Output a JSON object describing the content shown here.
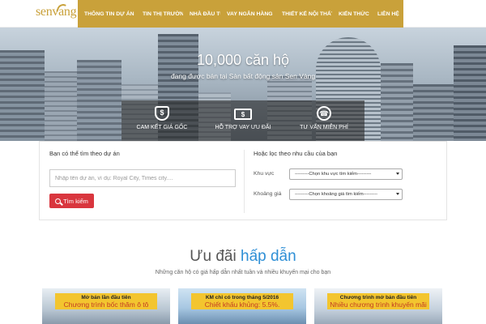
{
  "brand": {
    "logo_text": "senvang",
    "color": "#c9a13a"
  },
  "nav": {
    "items": [
      {
        "label": "THÔNG TIN DỰ ÁN"
      },
      {
        "label": "TIN THỊ TRƯỜNG"
      },
      {
        "label": "NHÀ ĐẦU TƯ"
      },
      {
        "label": "VAY NGÂN HÀNG"
      },
      {
        "label": "THIẾT KẾ NỘI THẤT"
      },
      {
        "label": "KIẾN THỨC"
      },
      {
        "label": "LIÊN HỆ"
      }
    ]
  },
  "hero": {
    "title": "10,000 căn hộ",
    "subtitle": "đang được bán tại Sàn bất động sản Sen Vàng",
    "benefits": [
      {
        "icon": "dollar-shield-icon",
        "label": "CAM KẾT GIÁ GỐC"
      },
      {
        "icon": "money-bill-icon",
        "label": "HỖ TRỢ VAY ƯU ĐÃI"
      },
      {
        "icon": "chat-phone-icon",
        "label": "TƯ VẤN MIỄN PHÍ"
      }
    ]
  },
  "search": {
    "left_title": "Bạn có thể tìm theo dự án",
    "input_placeholder": "Nhập tên dự án, ví dụ: Royal City, Times city....",
    "button_label": "Tìm kiếm",
    "right_title": "Hoặc lọc theo nhu cầu của bạn",
    "filters": [
      {
        "label": "Khu vực",
        "selected": "---------Chọn khu vực tìm kiếm---------"
      },
      {
        "label": "Khoảng giá",
        "selected": "---------Chọn khoảng giá tìm kiếm---------"
      }
    ]
  },
  "offers": {
    "title_part1": "Ưu đãi",
    "title_part2": "hấp dẫn",
    "subtitle": "Những căn hộ có giá hấp dẫn nhất tuần và nhiều khuyến mại cho bạn",
    "cards": [
      {
        "badge_title": "Mở bán lần đầu tiên",
        "badge_text": "Chương trình bốc thăm ô tô"
      },
      {
        "badge_title": "KM chỉ có trong tháng 5/2016",
        "badge_text": "Chiết khấu khủng: 5.5%."
      },
      {
        "badge_title": "Chương trình mở bán đầu tiên",
        "badge_text": "Nhiều chương trình khuyến mãi"
      }
    ]
  },
  "colors": {
    "accent_gold": "#c9a13a",
    "button_red": "#d9363e",
    "badge_yellow": "#f3c52f",
    "title_blue": "#2e8fd6"
  }
}
